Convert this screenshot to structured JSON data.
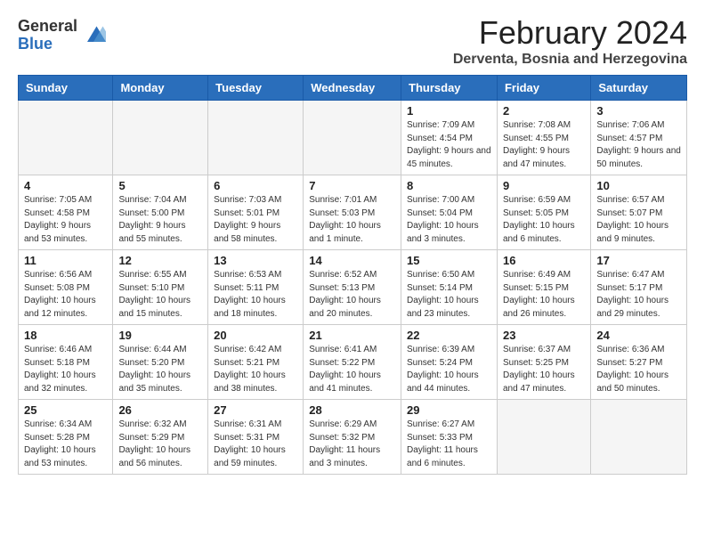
{
  "logo": {
    "general": "General",
    "blue": "Blue"
  },
  "title": "February 2024",
  "subtitle": "Derventa, Bosnia and Herzegovina",
  "days_of_week": [
    "Sunday",
    "Monday",
    "Tuesday",
    "Wednesday",
    "Thursday",
    "Friday",
    "Saturday"
  ],
  "weeks": [
    [
      {
        "day": "",
        "info": ""
      },
      {
        "day": "",
        "info": ""
      },
      {
        "day": "",
        "info": ""
      },
      {
        "day": "",
        "info": ""
      },
      {
        "day": "1",
        "info": "Sunrise: 7:09 AM\nSunset: 4:54 PM\nDaylight: 9 hours\nand 45 minutes."
      },
      {
        "day": "2",
        "info": "Sunrise: 7:08 AM\nSunset: 4:55 PM\nDaylight: 9 hours\nand 47 minutes."
      },
      {
        "day": "3",
        "info": "Sunrise: 7:06 AM\nSunset: 4:57 PM\nDaylight: 9 hours\nand 50 minutes."
      }
    ],
    [
      {
        "day": "4",
        "info": "Sunrise: 7:05 AM\nSunset: 4:58 PM\nDaylight: 9 hours\nand 53 minutes."
      },
      {
        "day": "5",
        "info": "Sunrise: 7:04 AM\nSunset: 5:00 PM\nDaylight: 9 hours\nand 55 minutes."
      },
      {
        "day": "6",
        "info": "Sunrise: 7:03 AM\nSunset: 5:01 PM\nDaylight: 9 hours\nand 58 minutes."
      },
      {
        "day": "7",
        "info": "Sunrise: 7:01 AM\nSunset: 5:03 PM\nDaylight: 10 hours\nand 1 minute."
      },
      {
        "day": "8",
        "info": "Sunrise: 7:00 AM\nSunset: 5:04 PM\nDaylight: 10 hours\nand 3 minutes."
      },
      {
        "day": "9",
        "info": "Sunrise: 6:59 AM\nSunset: 5:05 PM\nDaylight: 10 hours\nand 6 minutes."
      },
      {
        "day": "10",
        "info": "Sunrise: 6:57 AM\nSunset: 5:07 PM\nDaylight: 10 hours\nand 9 minutes."
      }
    ],
    [
      {
        "day": "11",
        "info": "Sunrise: 6:56 AM\nSunset: 5:08 PM\nDaylight: 10 hours\nand 12 minutes."
      },
      {
        "day": "12",
        "info": "Sunrise: 6:55 AM\nSunset: 5:10 PM\nDaylight: 10 hours\nand 15 minutes."
      },
      {
        "day": "13",
        "info": "Sunrise: 6:53 AM\nSunset: 5:11 PM\nDaylight: 10 hours\nand 18 minutes."
      },
      {
        "day": "14",
        "info": "Sunrise: 6:52 AM\nSunset: 5:13 PM\nDaylight: 10 hours\nand 20 minutes."
      },
      {
        "day": "15",
        "info": "Sunrise: 6:50 AM\nSunset: 5:14 PM\nDaylight: 10 hours\nand 23 minutes."
      },
      {
        "day": "16",
        "info": "Sunrise: 6:49 AM\nSunset: 5:15 PM\nDaylight: 10 hours\nand 26 minutes."
      },
      {
        "day": "17",
        "info": "Sunrise: 6:47 AM\nSunset: 5:17 PM\nDaylight: 10 hours\nand 29 minutes."
      }
    ],
    [
      {
        "day": "18",
        "info": "Sunrise: 6:46 AM\nSunset: 5:18 PM\nDaylight: 10 hours\nand 32 minutes."
      },
      {
        "day": "19",
        "info": "Sunrise: 6:44 AM\nSunset: 5:20 PM\nDaylight: 10 hours\nand 35 minutes."
      },
      {
        "day": "20",
        "info": "Sunrise: 6:42 AM\nSunset: 5:21 PM\nDaylight: 10 hours\nand 38 minutes."
      },
      {
        "day": "21",
        "info": "Sunrise: 6:41 AM\nSunset: 5:22 PM\nDaylight: 10 hours\nand 41 minutes."
      },
      {
        "day": "22",
        "info": "Sunrise: 6:39 AM\nSunset: 5:24 PM\nDaylight: 10 hours\nand 44 minutes."
      },
      {
        "day": "23",
        "info": "Sunrise: 6:37 AM\nSunset: 5:25 PM\nDaylight: 10 hours\nand 47 minutes."
      },
      {
        "day": "24",
        "info": "Sunrise: 6:36 AM\nSunset: 5:27 PM\nDaylight: 10 hours\nand 50 minutes."
      }
    ],
    [
      {
        "day": "25",
        "info": "Sunrise: 6:34 AM\nSunset: 5:28 PM\nDaylight: 10 hours\nand 53 minutes."
      },
      {
        "day": "26",
        "info": "Sunrise: 6:32 AM\nSunset: 5:29 PM\nDaylight: 10 hours\nand 56 minutes."
      },
      {
        "day": "27",
        "info": "Sunrise: 6:31 AM\nSunset: 5:31 PM\nDaylight: 10 hours\nand 59 minutes."
      },
      {
        "day": "28",
        "info": "Sunrise: 6:29 AM\nSunset: 5:32 PM\nDaylight: 11 hours\nand 3 minutes."
      },
      {
        "day": "29",
        "info": "Sunrise: 6:27 AM\nSunset: 5:33 PM\nDaylight: 11 hours\nand 6 minutes."
      },
      {
        "day": "",
        "info": ""
      },
      {
        "day": "",
        "info": ""
      }
    ]
  ]
}
